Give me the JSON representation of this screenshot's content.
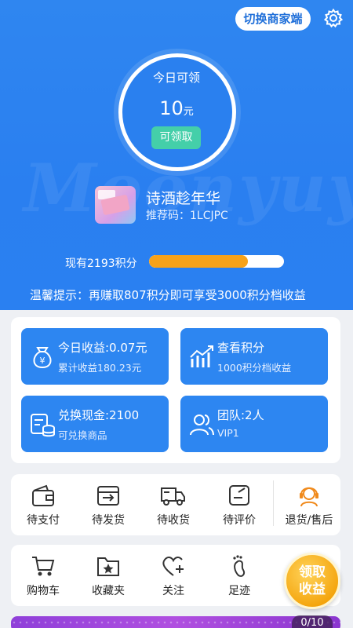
{
  "header": {
    "switch_label": "切换商家端",
    "settings_icon": "gear-icon"
  },
  "watermark": "Moonyuy",
  "today": {
    "title": "今日可领",
    "amount": "10",
    "unit": "元",
    "claim_label": "可领取"
  },
  "user": {
    "name": "诗酒趁年华",
    "ref_code": "推荐码：1LCJPC"
  },
  "points": {
    "label": "现有2193积分",
    "progress": 0.73
  },
  "tip": "温馨提示：再赚取807积分即可享受3000积分档收益",
  "cards": [
    {
      "title": "今日收益:0.07元",
      "sub": "累计收益180.23元",
      "icon": "money-bag-icon"
    },
    {
      "title": "查看积分",
      "sub": "1000积分档收益",
      "icon": "bar-chart-icon"
    },
    {
      "title": "兑换现金:2100",
      "sub": "可兑换商品",
      "icon": "coins-icon"
    },
    {
      "title": "团队:2人",
      "sub": "VIP1",
      "icon": "team-icon"
    }
  ],
  "orders": [
    {
      "label": "待支付",
      "icon": "wallet-icon"
    },
    {
      "label": "待发货",
      "icon": "package-icon"
    },
    {
      "label": "待收货",
      "icon": "truck-icon"
    },
    {
      "label": "待评价",
      "icon": "review-icon"
    },
    {
      "label": "退货/售后",
      "icon": "customer-service-icon"
    }
  ],
  "tools": [
    {
      "label": "购物车",
      "icon": "cart-icon"
    },
    {
      "label": "收藏夹",
      "icon": "folder-star-icon"
    },
    {
      "label": "关注",
      "icon": "heart-plus-icon"
    },
    {
      "label": "足迹",
      "icon": "footprint-icon"
    }
  ],
  "float_button": {
    "line1": "领取",
    "line2": "收益"
  },
  "page_indicator": "0/10",
  "colors": {
    "primary": "#2d86f1",
    "accent_green": "#44cfa9",
    "progress": "#f7a219",
    "orange_icon": "#f08a1c"
  }
}
